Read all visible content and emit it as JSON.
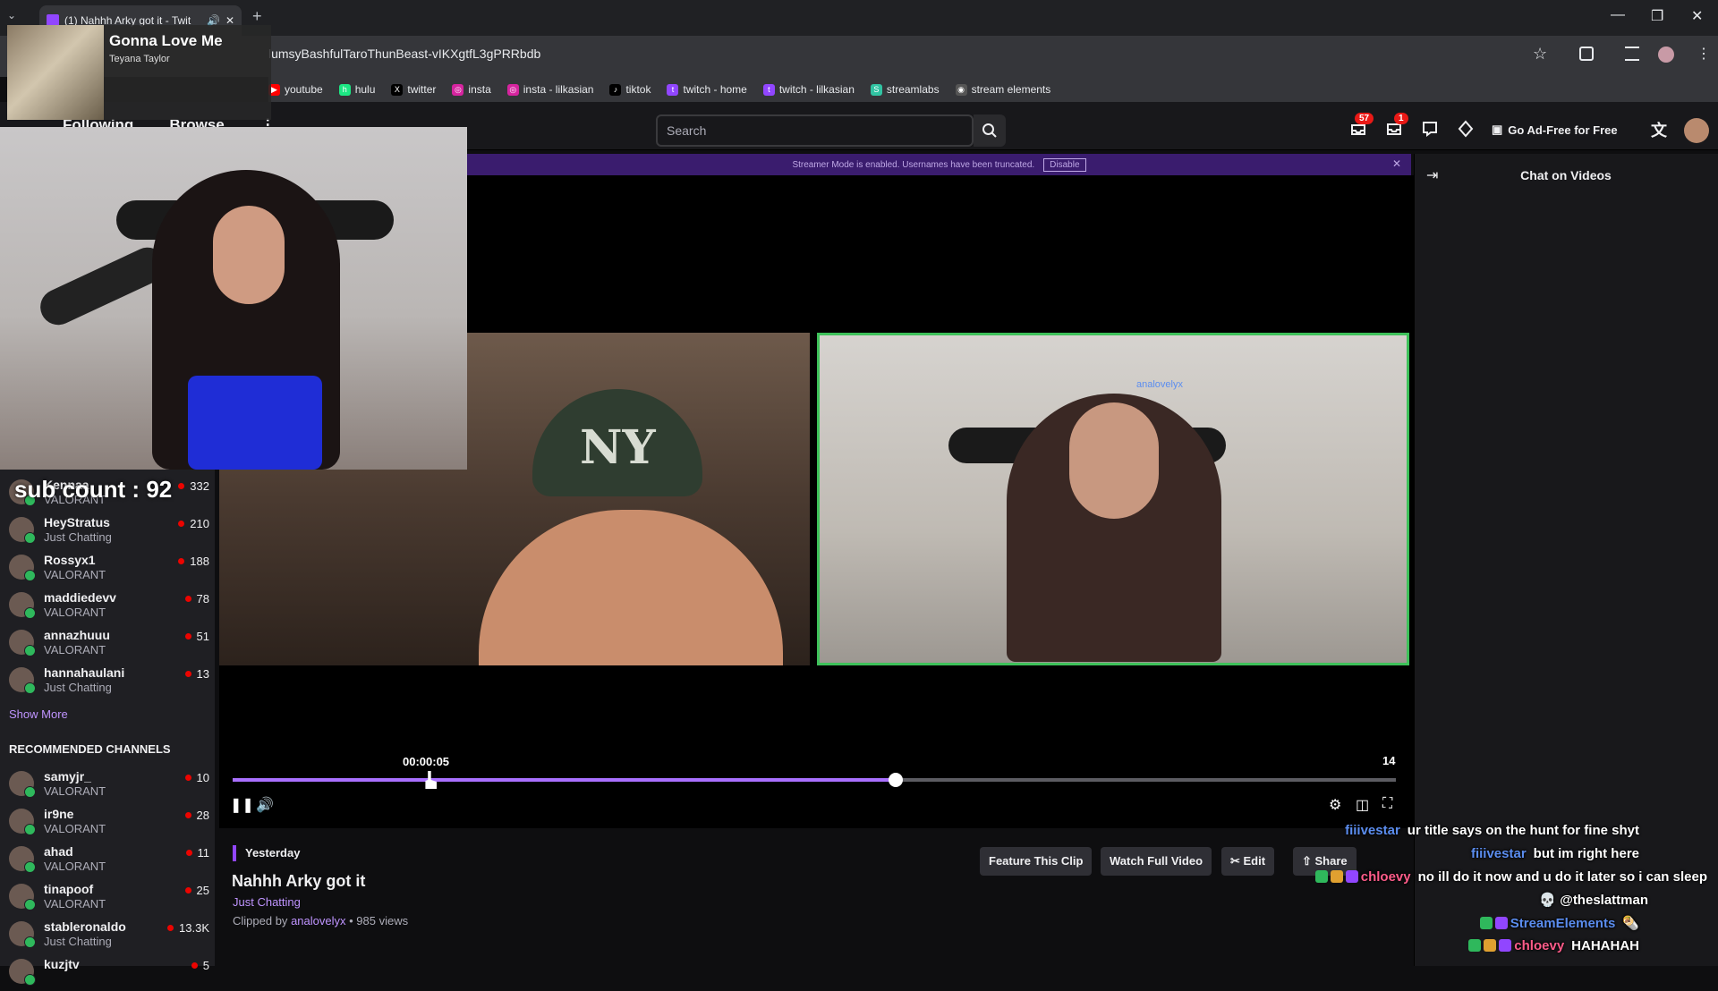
{
  "browser": {
    "tab_title": "(1) Nahhh Arky got it - Twit",
    "url": "lumsyBashfulTaroThunBeast-vIKXgtfL3gPRRbdb",
    "bookmarks": [
      {
        "label": "youtube",
        "color": "#ff0000",
        "glyph": "▶"
      },
      {
        "label": "hulu",
        "color": "#1ce783",
        "glyph": "h"
      },
      {
        "label": "twitter",
        "color": "#000000",
        "glyph": "X"
      },
      {
        "label": "insta",
        "color": "#d6249f",
        "glyph": "◎"
      },
      {
        "label": "insta - lilkasian",
        "color": "#d6249f",
        "glyph": "◎"
      },
      {
        "label": "tiktok",
        "color": "#000000",
        "glyph": "♪"
      },
      {
        "label": "twitch - home",
        "color": "#9146ff",
        "glyph": "t"
      },
      {
        "label": "twitch - lilkasian",
        "color": "#9146ff",
        "glyph": "t"
      },
      {
        "label": "streamlabs",
        "color": "#31c3a2",
        "glyph": "S"
      },
      {
        "label": "stream elements",
        "color": "#555555",
        "glyph": "◉"
      }
    ]
  },
  "music": {
    "song": "Gonna Love Me",
    "artist": "Teyana Taylor"
  },
  "nav": {
    "following": "Following",
    "browse": "Browse",
    "more": "⋮",
    "search_placeholder": "Search",
    "notif_count": "57",
    "inbox_count": "1",
    "adfree": "Go Ad-Free for Free"
  },
  "banner": {
    "text": "Streamer Mode is enabled. Usernames have been truncated.",
    "disable": "Disable"
  },
  "overlay": {
    "sub_count": "sub count : 92",
    "cam_name": "analovelyx"
  },
  "sidebar": {
    "followed": [
      {
        "name": "Kennaa",
        "game": "VALORANT",
        "viewers": "332"
      },
      {
        "name": "HeyStratus",
        "game": "Just Chatting",
        "viewers": "210"
      },
      {
        "name": "Rossyx1",
        "game": "VALORANT",
        "viewers": "188"
      },
      {
        "name": "maddiedevv",
        "game": "VALORANT",
        "viewers": "78"
      },
      {
        "name": "annazhuuu",
        "game": "VALORANT",
        "viewers": "51"
      },
      {
        "name": "hannahaulani",
        "game": "Just Chatting",
        "viewers": "13"
      }
    ],
    "show_more": "Show More",
    "recommended_heading": "RECOMMENDED CHANNELS",
    "recommended": [
      {
        "name": "samyjr_",
        "game": "VALORANT",
        "viewers": "10"
      },
      {
        "name": "ir9ne",
        "game": "VALORANT",
        "viewers": "28"
      },
      {
        "name": "ahad",
        "game": "VALORANT",
        "viewers": "11"
      },
      {
        "name": "tinapoof",
        "game": "VALORANT",
        "viewers": "25"
      },
      {
        "name": "stableronaldo",
        "game": "Just Chatting",
        "viewers": "13.3K"
      },
      {
        "name": "kuzjtv",
        "game": "",
        "viewers": "5"
      }
    ]
  },
  "player": {
    "current_time": "00:00:05",
    "end_time": "14",
    "progress": 0.57,
    "hover": 0.14
  },
  "clip": {
    "when": "Yesterday",
    "title": "Nahhh Arky got it",
    "category": "Just Chatting",
    "clipped_by_prefix": "Clipped by",
    "clipper": "analovelyx",
    "views": "• 985 views",
    "feature_btn": "Feature This Clip",
    "watch_btn": "Watch Full Video",
    "edit_btn": "Edit",
    "share_btn": "Share"
  },
  "chat": {
    "header": "Chat on Videos",
    "messages": [
      {
        "user": "fiiivestar",
        "color": "#5b8def",
        "text": "ur title says on the hunt for fine shyt",
        "badges": []
      },
      {
        "user": "fiiivestar",
        "color": "#5b8def",
        "text": "but im right here",
        "badges": []
      },
      {
        "user": "chloevy",
        "color": "#ff5c8a",
        "text": "no ill do it now and u do it later so i can sleep",
        "badges": [
          "#2fb85c",
          "#e0a030",
          "#9146ff"
        ]
      },
      {
        "user": "",
        "color": "#ffffff",
        "text": "💀 @theslattman",
        "badges": []
      },
      {
        "user": "StreamElements",
        "color": "#5b8def",
        "text": "🌯",
        "badges": [
          "#2fb85c",
          "#9146ff"
        ]
      },
      {
        "user": "chloevy",
        "color": "#ff5c8a",
        "text": "HAHAHAH",
        "badges": [
          "#2fb85c",
          "#e0a030",
          "#9146ff"
        ]
      }
    ]
  }
}
